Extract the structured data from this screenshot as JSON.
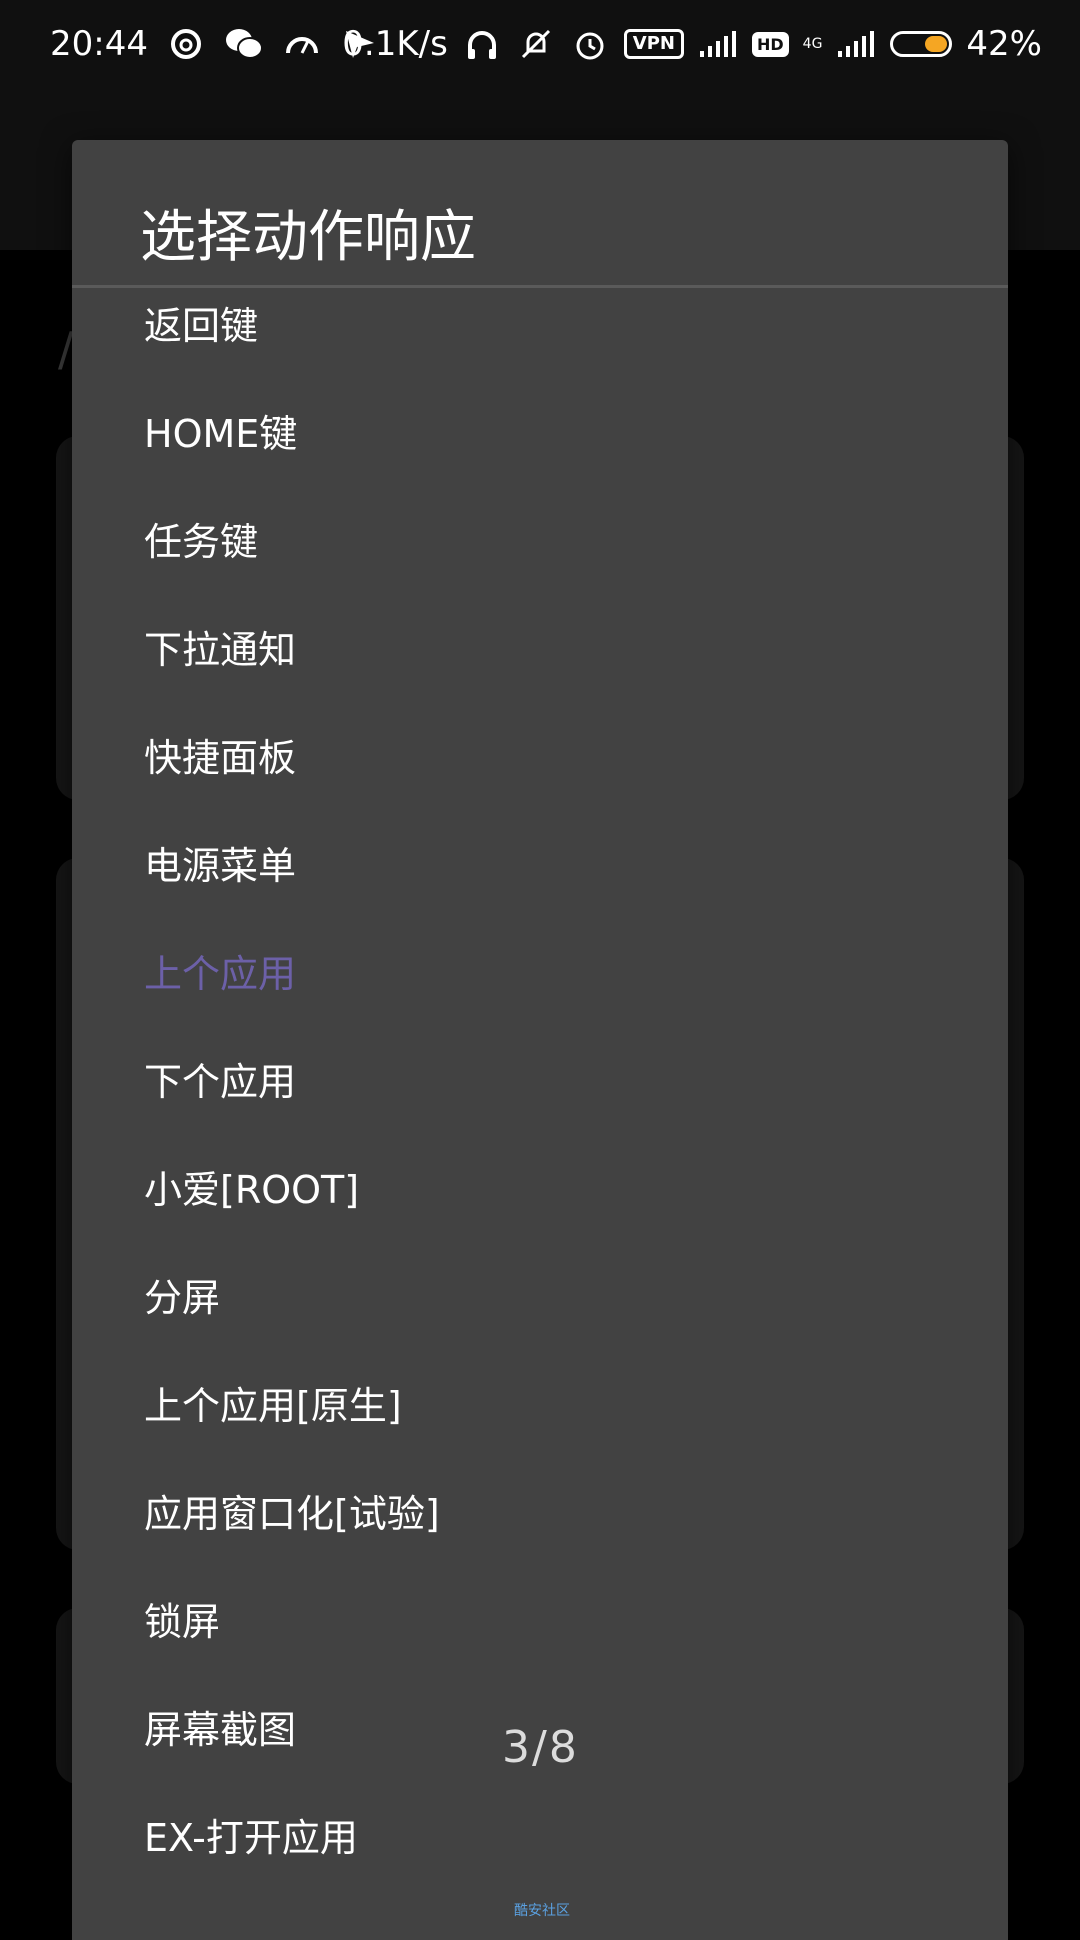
{
  "status_bar": {
    "time": "20:44",
    "net_speed": "0.1K/s",
    "vpn_label": "VPN",
    "hd_label": "HD",
    "network_type": "4G",
    "battery_percent": "42%",
    "battery_color": "#f5a623",
    "left_icons": [
      "netease-music-icon",
      "wechat-icon",
      "speedometer-icon",
      "send-icon"
    ],
    "right_icons": [
      "headphones-icon",
      "mute-bell-icon",
      "alarm-icon",
      "vpn-icon",
      "signal-icon",
      "hd-icon",
      "signal-4g-icon",
      "battery-icon"
    ]
  },
  "dialog": {
    "title": "选择动作响应",
    "options": [
      "返回键",
      "HOME键",
      "任务键",
      "下拉通知",
      "快捷面板",
      "电源菜单",
      "上个应用",
      "下个应用",
      "小爱[ROOT]",
      "分屏",
      "上个应用[原生]",
      "应用窗口化[试验]",
      "锁屏",
      "屏幕截图",
      "EX-打开应用"
    ],
    "selected_index": 6,
    "selected_color": "#6c60a8"
  },
  "overlay": {
    "page_indicator": "3/8",
    "watermark": "酷安社区"
  }
}
